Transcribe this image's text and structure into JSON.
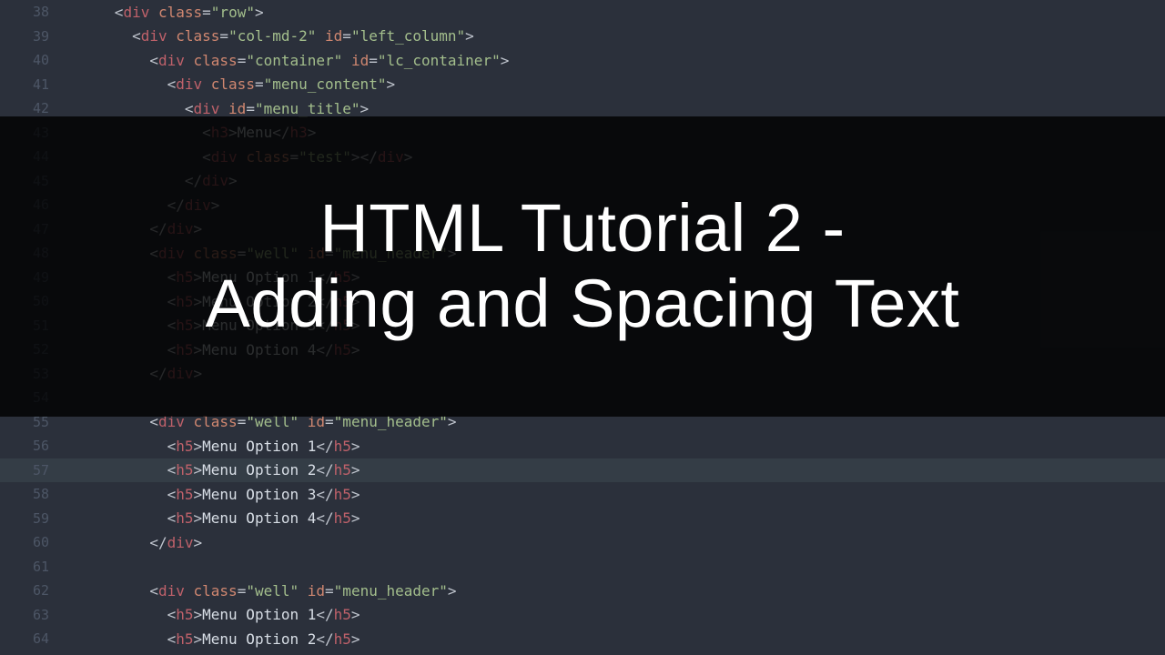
{
  "overlay": {
    "line1": "HTML Tutorial 2 -",
    "line2": "Adding and Spacing Text"
  },
  "code_lines": [
    {
      "num": 38,
      "indent": 3,
      "tokens": [
        [
          "p",
          "<"
        ],
        [
          "tag",
          "div"
        ],
        [
          "p",
          " "
        ],
        [
          "attr",
          "class"
        ],
        [
          "p",
          "="
        ],
        [
          "str",
          "\"row\""
        ],
        [
          "p",
          ">"
        ]
      ]
    },
    {
      "num": 39,
      "indent": 4,
      "tokens": [
        [
          "p",
          "<"
        ],
        [
          "tag",
          "div"
        ],
        [
          "p",
          " "
        ],
        [
          "attr",
          "class"
        ],
        [
          "p",
          "="
        ],
        [
          "str",
          "\"col-md-2\""
        ],
        [
          "p",
          " "
        ],
        [
          "attr",
          "id"
        ],
        [
          "p",
          "="
        ],
        [
          "str",
          "\"left_column\""
        ],
        [
          "p",
          ">"
        ]
      ]
    },
    {
      "num": 40,
      "indent": 5,
      "tokens": [
        [
          "p",
          "<"
        ],
        [
          "tag",
          "div"
        ],
        [
          "p",
          " "
        ],
        [
          "attr",
          "class"
        ],
        [
          "p",
          "="
        ],
        [
          "str",
          "\"container\""
        ],
        [
          "p",
          " "
        ],
        [
          "attr",
          "id"
        ],
        [
          "p",
          "="
        ],
        [
          "str",
          "\"lc_container\""
        ],
        [
          "p",
          ">"
        ]
      ]
    },
    {
      "num": 41,
      "indent": 6,
      "tokens": [
        [
          "p",
          "<"
        ],
        [
          "tag",
          "div"
        ],
        [
          "p",
          " "
        ],
        [
          "attr",
          "class"
        ],
        [
          "p",
          "="
        ],
        [
          "str",
          "\"menu_content\""
        ],
        [
          "p",
          ">"
        ]
      ]
    },
    {
      "num": 42,
      "indent": 7,
      "tokens": [
        [
          "p",
          "<"
        ],
        [
          "tag",
          "div"
        ],
        [
          "p",
          " "
        ],
        [
          "attr",
          "id"
        ],
        [
          "p",
          "="
        ],
        [
          "str",
          "\"menu_title\""
        ],
        [
          "p",
          ">"
        ]
      ]
    },
    {
      "num": 43,
      "indent": 8,
      "tokens": [
        [
          "p",
          "<"
        ],
        [
          "tag",
          "h3"
        ],
        [
          "p",
          ">"
        ],
        [
          "txt",
          "Menu"
        ],
        [
          "p",
          "</"
        ],
        [
          "tag",
          "h3"
        ],
        [
          "p",
          ">"
        ]
      ]
    },
    {
      "num": 44,
      "indent": 8,
      "tokens": [
        [
          "p",
          "<"
        ],
        [
          "tag",
          "div"
        ],
        [
          "p",
          " "
        ],
        [
          "attr",
          "class"
        ],
        [
          "p",
          "="
        ],
        [
          "str",
          "\"test\""
        ],
        [
          "p",
          ">"
        ],
        [
          "p",
          "</"
        ],
        [
          "tag",
          "div"
        ],
        [
          "p",
          ">"
        ]
      ]
    },
    {
      "num": 45,
      "indent": 7,
      "tokens": [
        [
          "p",
          "</"
        ],
        [
          "tag",
          "div"
        ],
        [
          "p",
          ">"
        ]
      ]
    },
    {
      "num": 46,
      "indent": 6,
      "tokens": [
        [
          "p",
          "</"
        ],
        [
          "tag",
          "div"
        ],
        [
          "p",
          ">"
        ]
      ]
    },
    {
      "num": 47,
      "indent": 5,
      "tokens": [
        [
          "p",
          "</"
        ],
        [
          "tag",
          "div"
        ],
        [
          "p",
          ">"
        ]
      ]
    },
    {
      "num": 48,
      "indent": 5,
      "tokens": [
        [
          "p",
          "<"
        ],
        [
          "tag",
          "div"
        ],
        [
          "p",
          " "
        ],
        [
          "attr",
          "class"
        ],
        [
          "p",
          "="
        ],
        [
          "str",
          "\"well\""
        ],
        [
          "p",
          " "
        ],
        [
          "attr",
          "id"
        ],
        [
          "p",
          "="
        ],
        [
          "str",
          "\"menu_header\""
        ],
        [
          "p",
          ">"
        ]
      ]
    },
    {
      "num": 49,
      "indent": 6,
      "tokens": [
        [
          "p",
          "<"
        ],
        [
          "tag",
          "h5"
        ],
        [
          "p",
          ">"
        ],
        [
          "txt",
          "Menu Option 1"
        ],
        [
          "p",
          "</"
        ],
        [
          "tag",
          "h5"
        ],
        [
          "p",
          ">"
        ]
      ]
    },
    {
      "num": 50,
      "indent": 6,
      "tokens": [
        [
          "p",
          "<"
        ],
        [
          "tag",
          "h5"
        ],
        [
          "p",
          ">"
        ],
        [
          "txt",
          "Menu Option 2"
        ],
        [
          "p",
          "</"
        ],
        [
          "tag",
          "h5"
        ],
        [
          "p",
          ">"
        ]
      ]
    },
    {
      "num": 51,
      "indent": 6,
      "tokens": [
        [
          "p",
          "<"
        ],
        [
          "tag",
          "h5"
        ],
        [
          "p",
          ">"
        ],
        [
          "txt",
          "Menu Option 3"
        ],
        [
          "p",
          "</"
        ],
        [
          "tag",
          "h5"
        ],
        [
          "p",
          ">"
        ]
      ]
    },
    {
      "num": 52,
      "indent": 6,
      "tokens": [
        [
          "p",
          "<"
        ],
        [
          "tag",
          "h5"
        ],
        [
          "p",
          ">"
        ],
        [
          "txt",
          "Menu Option 4"
        ],
        [
          "p",
          "</"
        ],
        [
          "tag",
          "h5"
        ],
        [
          "p",
          ">"
        ]
      ]
    },
    {
      "num": 53,
      "indent": 5,
      "tokens": [
        [
          "p",
          "</"
        ],
        [
          "tag",
          "div"
        ],
        [
          "p",
          ">"
        ]
      ]
    },
    {
      "num": 54,
      "indent": 0,
      "tokens": []
    },
    {
      "num": 55,
      "indent": 5,
      "tokens": [
        [
          "p",
          "<"
        ],
        [
          "tag",
          "div"
        ],
        [
          "p",
          " "
        ],
        [
          "attr",
          "class"
        ],
        [
          "p",
          "="
        ],
        [
          "str",
          "\"well\""
        ],
        [
          "p",
          " "
        ],
        [
          "attr",
          "id"
        ],
        [
          "p",
          "="
        ],
        [
          "str",
          "\"menu_header\""
        ],
        [
          "p",
          ">"
        ]
      ]
    },
    {
      "num": 56,
      "indent": 6,
      "tokens": [
        [
          "p",
          "<"
        ],
        [
          "tag",
          "h5"
        ],
        [
          "p",
          ">"
        ],
        [
          "txt",
          "Menu Option 1"
        ],
        [
          "p",
          "</"
        ],
        [
          "tag",
          "h5"
        ],
        [
          "p",
          ">"
        ]
      ]
    },
    {
      "num": 57,
      "indent": 6,
      "hl": true,
      "tokens": [
        [
          "p",
          "<"
        ],
        [
          "tag",
          "h5"
        ],
        [
          "p",
          ">"
        ],
        [
          "txt",
          "Menu Option 2"
        ],
        [
          "p",
          "</"
        ],
        [
          "tag",
          "h5"
        ],
        [
          "p",
          ">"
        ]
      ]
    },
    {
      "num": 58,
      "indent": 6,
      "tokens": [
        [
          "p",
          "<"
        ],
        [
          "tag",
          "h5"
        ],
        [
          "p",
          ">"
        ],
        [
          "txt",
          "Menu Option 3"
        ],
        [
          "p",
          "</"
        ],
        [
          "tag",
          "h5"
        ],
        [
          "p",
          ">"
        ]
      ]
    },
    {
      "num": 59,
      "indent": 6,
      "tokens": [
        [
          "p",
          "<"
        ],
        [
          "tag",
          "h5"
        ],
        [
          "p",
          ">"
        ],
        [
          "txt",
          "Menu Option 4"
        ],
        [
          "p",
          "</"
        ],
        [
          "tag",
          "h5"
        ],
        [
          "p",
          ">"
        ]
      ]
    },
    {
      "num": 60,
      "indent": 5,
      "tokens": [
        [
          "p",
          "</"
        ],
        [
          "tag",
          "div"
        ],
        [
          "p",
          ">"
        ]
      ]
    },
    {
      "num": 61,
      "indent": 0,
      "tokens": []
    },
    {
      "num": 62,
      "indent": 5,
      "tokens": [
        [
          "p",
          "<"
        ],
        [
          "tag",
          "div"
        ],
        [
          "p",
          " "
        ],
        [
          "attr",
          "class"
        ],
        [
          "p",
          "="
        ],
        [
          "str",
          "\"well\""
        ],
        [
          "p",
          " "
        ],
        [
          "attr",
          "id"
        ],
        [
          "p",
          "="
        ],
        [
          "str",
          "\"menu_header\""
        ],
        [
          "p",
          ">"
        ]
      ]
    },
    {
      "num": 63,
      "indent": 6,
      "tokens": [
        [
          "p",
          "<"
        ],
        [
          "tag",
          "h5"
        ],
        [
          "p",
          ">"
        ],
        [
          "txt",
          "Menu Option 1"
        ],
        [
          "p",
          "</"
        ],
        [
          "tag",
          "h5"
        ],
        [
          "p",
          ">"
        ]
      ]
    },
    {
      "num": 64,
      "indent": 6,
      "tokens": [
        [
          "p",
          "<"
        ],
        [
          "tag",
          "h5"
        ],
        [
          "p",
          ">"
        ],
        [
          "txt",
          "Menu Option 2"
        ],
        [
          "p",
          "</"
        ],
        [
          "tag",
          "h5"
        ],
        [
          "p",
          ">"
        ]
      ]
    }
  ]
}
